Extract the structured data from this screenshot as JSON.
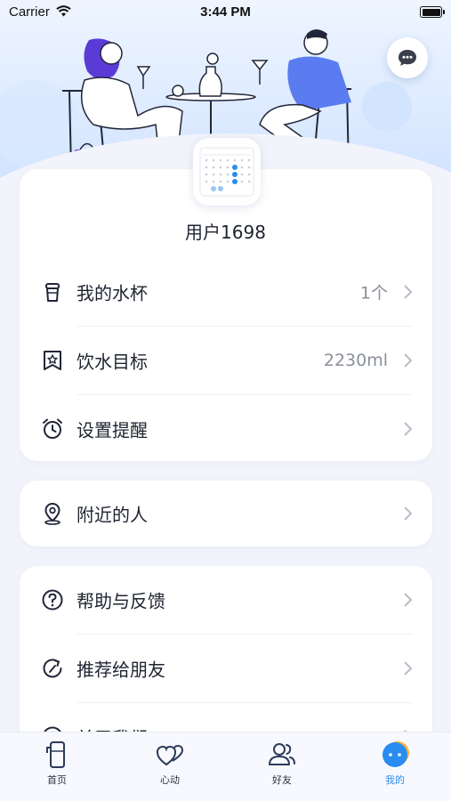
{
  "status_bar": {
    "carrier": "Carrier",
    "time": "3:44 PM"
  },
  "profile": {
    "username": "用户1698"
  },
  "menu": {
    "cup": {
      "label": "我的水杯",
      "value": "1个"
    },
    "goal": {
      "label": "饮水目标",
      "value": "2230ml"
    },
    "reminder": {
      "label": "设置提醒"
    },
    "nearby": {
      "label": "附近的人"
    },
    "help": {
      "label": "帮助与反馈"
    },
    "recommend": {
      "label": "推荐给朋友"
    },
    "about": {
      "label": "关于我们"
    }
  },
  "tabs": [
    {
      "label": "首页",
      "icon": "cup-icon"
    },
    {
      "label": "心动",
      "icon": "hearts-icon"
    },
    {
      "label": "好友",
      "icon": "friends-icon"
    },
    {
      "label": "我的",
      "icon": "profile-dots-icon",
      "active": true
    }
  ],
  "colors": {
    "accent": "#2a8cf0",
    "illustration_blue": "#5b7cf0",
    "illustration_purple": "#5a3bd6"
  }
}
